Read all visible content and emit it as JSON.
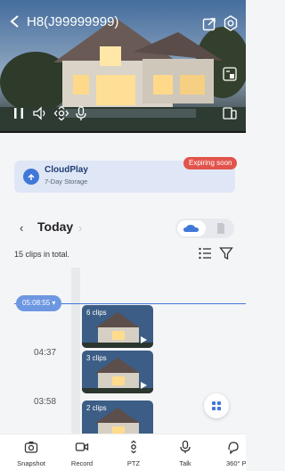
{
  "header": {
    "title": "H8(J99999999)"
  },
  "icons": {
    "back": "chevron-left-icon",
    "share": "share-icon",
    "settings": "gear-icon",
    "pip": "picture-in-picture-icon",
    "pause": "pause-icon",
    "volume": "volume-icon",
    "ptz": "ptz-icon",
    "mic": "mic-icon",
    "fullscreen": "split-screen-icon"
  },
  "cloud": {
    "title": "CloudPlay",
    "subtitle": "7-Day Storage",
    "badge": "Expiring soon"
  },
  "date_nav": {
    "label": "Today"
  },
  "clips": {
    "count_text": "15 clips in total.",
    "current_time": "05:08:55 ▾",
    "groups": [
      {
        "label": "6 clips",
        "time": ""
      },
      {
        "label": "3 clips",
        "time": "04:37"
      },
      {
        "label": "2 clips",
        "time": "03:58"
      }
    ]
  },
  "toolbar": {
    "items": [
      {
        "label": "Snapshot",
        "icon": "camera-icon"
      },
      {
        "label": "Record",
        "icon": "video-icon"
      },
      {
        "label": "PTZ",
        "icon": "ptz-icon"
      },
      {
        "label": "Talk",
        "icon": "mic-icon"
      },
      {
        "label": "360° P",
        "icon": "panorama-icon"
      }
    ]
  },
  "colors": {
    "accent": "#3f78d8",
    "badge": "#e2534b",
    "card": "#dfe7f6"
  }
}
